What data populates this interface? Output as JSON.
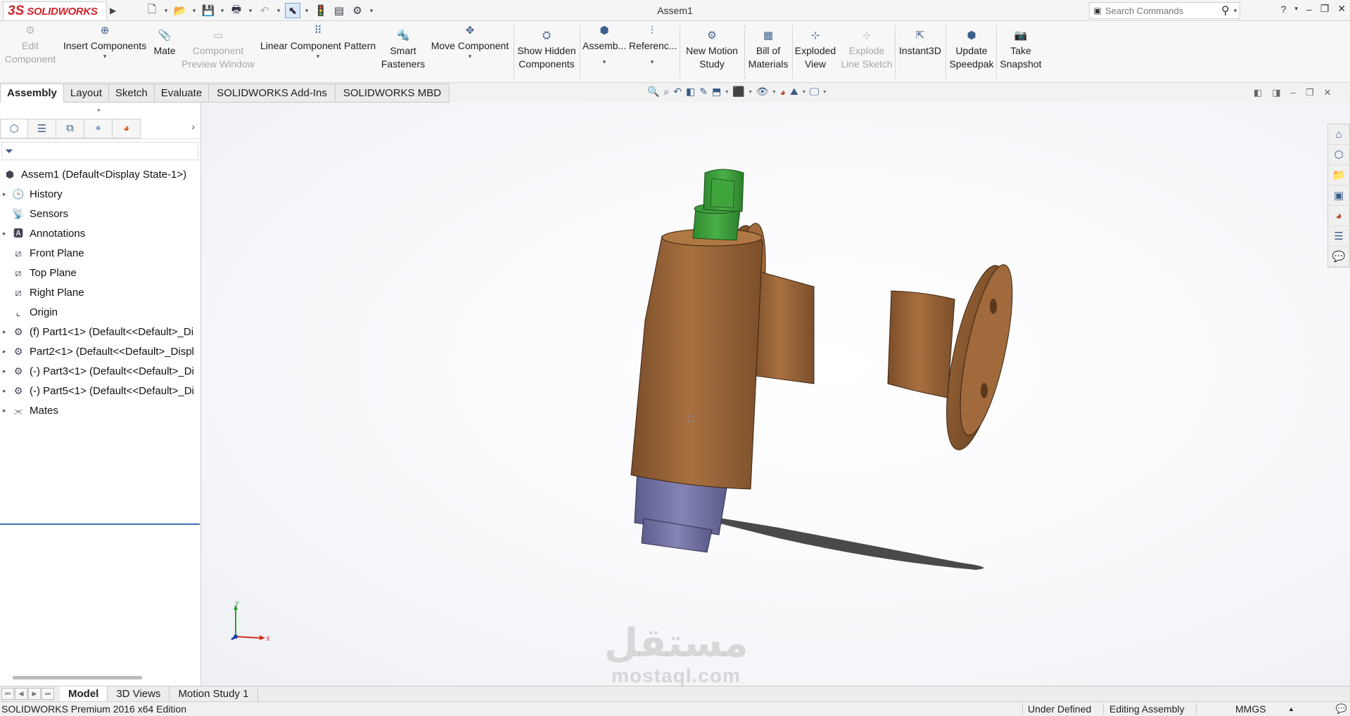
{
  "app": {
    "brand_prefix": "3S",
    "brand": "SOLIDWORKS",
    "title": "Assem1",
    "search_placeholder": "Search Commands",
    "help_label": "?"
  },
  "ribbon": {
    "edit_component": [
      "Edit",
      "Component"
    ],
    "insert_components": "Insert Components",
    "mate": "Mate",
    "component_preview": [
      "Component",
      "Preview Window"
    ],
    "linear_pattern": "Linear Component Pattern",
    "smart_fasteners": [
      "Smart",
      "Fasteners"
    ],
    "move_component": "Move Component",
    "show_hidden": [
      "Show Hidden",
      "Components"
    ],
    "assembly": "Assemb...",
    "reference": "Referenc...",
    "motion_study": [
      "New Motion",
      "Study"
    ],
    "bom": [
      "Bill of",
      "Materials"
    ],
    "exploded": [
      "Exploded",
      "View"
    ],
    "explode_line": [
      "Explode",
      "Line Sketch"
    ],
    "instant3d": "Instant3D",
    "speedpak": [
      "Update",
      "Speedpak"
    ],
    "snapshot": [
      "Take",
      "Snapshot"
    ]
  },
  "tabs": [
    "Assembly",
    "Layout",
    "Sketch",
    "Evaluate",
    "SOLIDWORKS Add-Ins",
    "SOLIDWORKS MBD"
  ],
  "tree": {
    "root": "Assem1  (Default<Display State-1>)",
    "items": [
      {
        "label": "History",
        "icon": "history-icon",
        "expandable": true
      },
      {
        "label": "Sensors",
        "icon": "sensor-icon",
        "expandable": false
      },
      {
        "label": "Annotations",
        "icon": "annotations-icon",
        "expandable": true
      },
      {
        "label": "Front Plane",
        "icon": "plane-icon",
        "expandable": false
      },
      {
        "label": "Top Plane",
        "icon": "plane-icon",
        "expandable": false
      },
      {
        "label": "Right Plane",
        "icon": "plane-icon",
        "expandable": false
      },
      {
        "label": "Origin",
        "icon": "origin-icon",
        "expandable": false
      },
      {
        "label": "(f) Part1<1> (Default<<Default>_Di",
        "icon": "part-icon",
        "expandable": true
      },
      {
        "label": "Part2<1> (Default<<Default>_Displ",
        "icon": "part-icon",
        "expandable": true
      },
      {
        "label": "(-) Part3<1> (Default<<Default>_Di",
        "icon": "part-icon",
        "expandable": true
      },
      {
        "label": "(-) Part5<1> (Default<<Default>_Di",
        "icon": "part-icon",
        "expandable": true
      },
      {
        "label": "Mates",
        "icon": "mates-icon",
        "expandable": true
      }
    ]
  },
  "bottom_tabs": [
    "Model",
    "3D Views",
    "Motion Study 1"
  ],
  "status": {
    "edition": "SOLIDWORKS Premium 2016 x64 Edition",
    "defined": "Under Defined",
    "mode": "Editing Assembly",
    "units": "MMGS"
  },
  "triad": {
    "y": "Y",
    "x": "X"
  },
  "watermark": {
    "arabic": "مستقل",
    "latin": "mostaql.com"
  },
  "colors": {
    "brand_red": "#d0232b",
    "body_bronze": "#9a6536",
    "stem_green": "#3c9b3a",
    "bonnet_blue": "#6f6fa0",
    "tab_accent": "#3a6db0"
  }
}
